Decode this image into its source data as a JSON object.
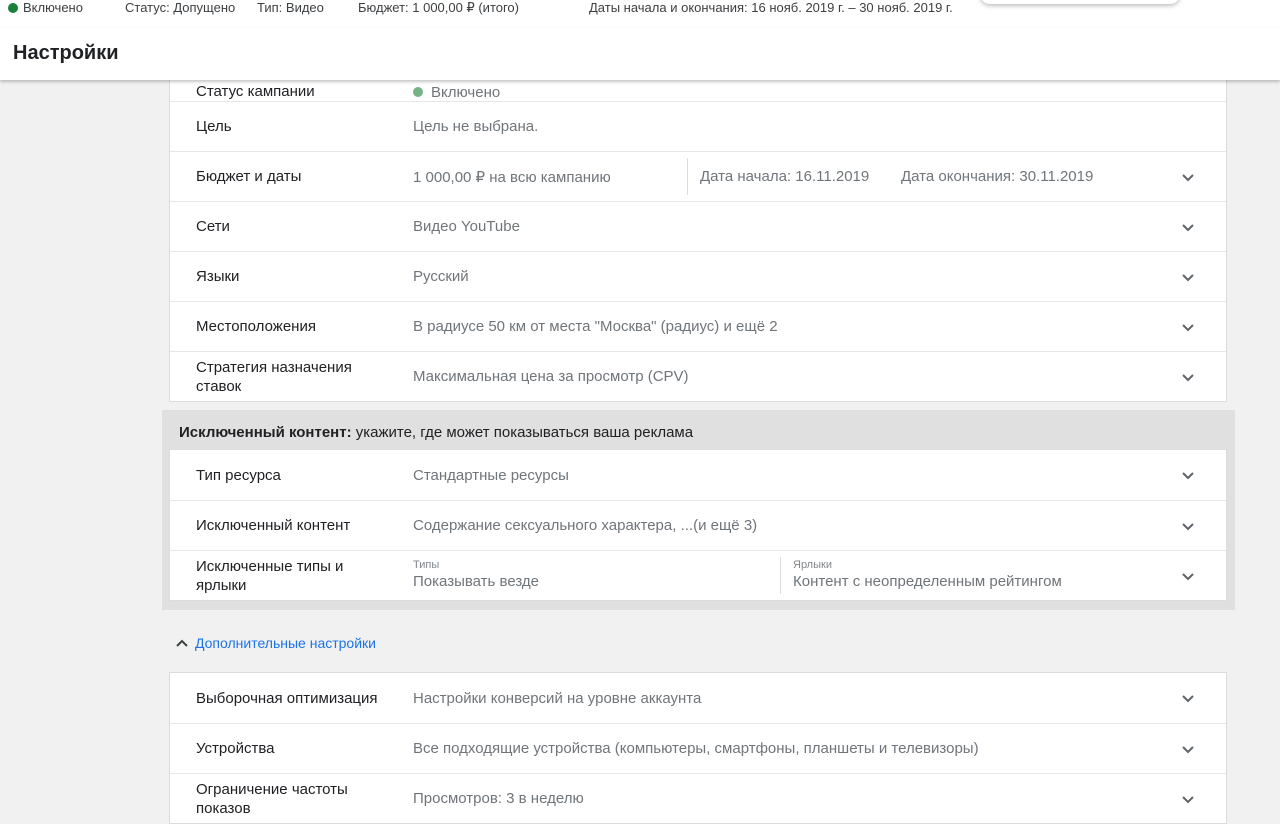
{
  "topbar": {
    "status_on": "Включено",
    "status": "Статус: Допущено",
    "type": "Тип: Видео",
    "budget": "Бюджет: 1 000,00 ₽ (итого)",
    "dates": "Даты начала и окончания: 16 нояб. 2019 г. – 30 нояб. 2019 г."
  },
  "header": {
    "title": "Настройки"
  },
  "colors": {
    "green": "#188038",
    "link": "#1a73e8",
    "panel": "#e0e0e0"
  },
  "icons": {
    "expand": "chevron-down-icon",
    "collapse": "chevron-up-icon"
  },
  "settings": {
    "status_label": "Статус кампании",
    "status_value": "Включено",
    "goal_label": "Цель",
    "goal_value": "Цель не выбрана.",
    "budget_label": "Бюджет и даты",
    "budget_value": "1 000,00 ₽ на всю кампанию",
    "start_date": "Дата начала: 16.11.2019",
    "end_date": "Дата окончания: 30.11.2019",
    "networks_label": "Сети",
    "networks_value": "Видео YouTube",
    "languages_label": "Языки",
    "languages_value": "Русский",
    "locations_label": "Местоположения",
    "locations_value": "В радиусе 50 км от места \"Москва\" (радиус) и ещё 2",
    "bidding_label": "Стратегия назначения ставок",
    "bidding_value": "Максимальная цена за просмотр (CPV)"
  },
  "excluded": {
    "heading_bold": "Исключенный контент:",
    "heading_rest": " укажите, где может показываться ваша реклама",
    "inventory_label": "Тип ресурса",
    "inventory_value": "Стандартные ресурсы",
    "content_label": "Исключенный контент",
    "content_value": "Содержание сексуального характера, ...(и ещё 3)",
    "types_label": "Исключенные типы и ярлыки",
    "types_caption": "Типы",
    "types_value": "Показывать везде",
    "labels_caption": "Ярлыки",
    "labels_value": "Контент с неопределенным рейтингом"
  },
  "advanced": {
    "toggle": "Дополнительные настройки",
    "optimization_label": "Выборочная оптимизация",
    "optimization_value": "Настройки конверсий на уровне аккаунта",
    "devices_label": "Устройства",
    "devices_value": "Все подходящие устройства (компьютеры, смартфоны, планшеты и телевизоры)",
    "frequency_label": "Ограничение частоты показов",
    "frequency_value": "Просмотров: 3 в неделю"
  }
}
